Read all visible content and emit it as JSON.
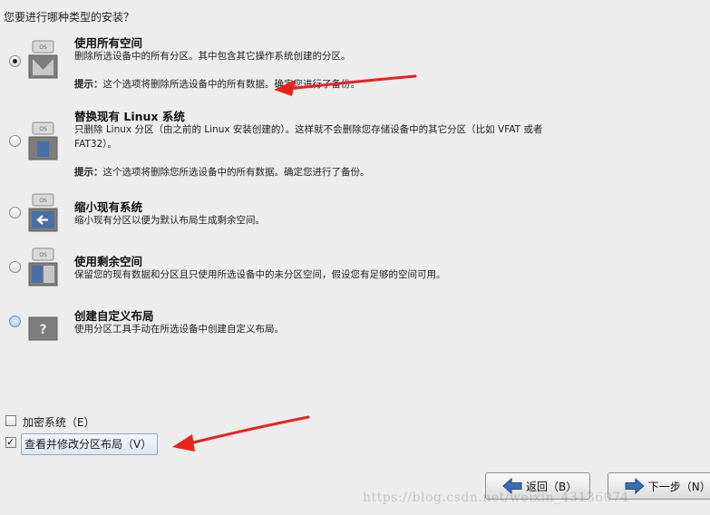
{
  "question": "您要进行哪种类型的安装？",
  "options": [
    {
      "title": "使用所有空间",
      "desc": "删除所选设备中的所有分区。其中包含其它操作系统创建的分区。",
      "tip_label": "提示：",
      "tip_text": "这个选项将删除所选设备中的所有数据。确定您进行了备份。",
      "icon": "os-disk-full-icon",
      "selected": true,
      "os_label": "OS"
    },
    {
      "title": "替换现有 Linux 系统",
      "desc": "只删除 Linux 分区（由之前的 Linux 安装创建的）。这样就不会删除您存储设备中的其它分区（比如 VFAT 或者 FAT32）。",
      "tip_label": "提示：",
      "tip_text": "这个选项将删除您所选设备中的所有数据。确定您进行了备份。",
      "icon": "os-disk-replace-icon",
      "selected": false,
      "os_label": "OS"
    },
    {
      "title": "缩小现有系统",
      "desc": "缩小现有分区以便为默认布局生成剩余空间。",
      "icon": "os-disk-shrink-icon",
      "selected": false,
      "os_label": "OS"
    },
    {
      "title": "使用剩余空间",
      "desc": "保留您的现有数据和分区且只使用所选设备中的未分区空间，假设您有足够的空间可用。",
      "icon": "os-disk-free-icon",
      "selected": false,
      "os_label": "OS"
    },
    {
      "title": "创建自定义布局",
      "desc": "使用分区工具手动在所选设备中创建自定义布局。",
      "icon": "custom-layout-icon",
      "selected": false,
      "icon_text": "?"
    }
  ],
  "checkboxes": {
    "encrypt": {
      "label": "加密系统（E）",
      "checked": false
    },
    "review": {
      "label": "查看并修改分区布局（V）",
      "checked": true,
      "tick": "✓"
    }
  },
  "buttons": {
    "back": "返回（B）",
    "next": "下一步（N）"
  },
  "watermark": "https://blog.csdn.net/weixin_43136074",
  "colors": {
    "annotation_arrow": "#e8231d",
    "background": "#ededed",
    "selection_blue": "#4a6fa5"
  }
}
